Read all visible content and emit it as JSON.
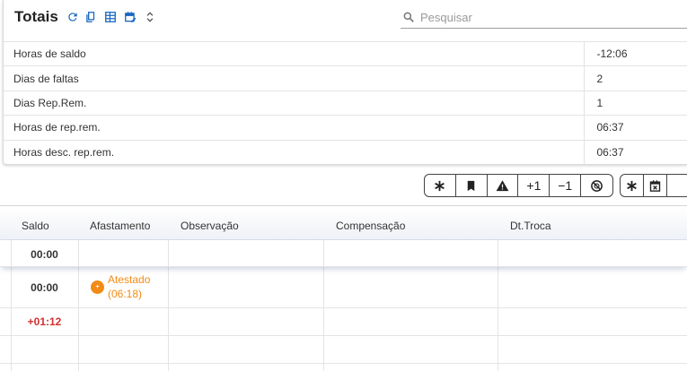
{
  "totals": {
    "title": "Totais",
    "search_placeholder": "Pesquisar",
    "search_value": "",
    "rows": [
      {
        "label": "Horas de saldo",
        "value": "-12:06"
      },
      {
        "label": "Dias de faltas",
        "value": "2"
      },
      {
        "label": "Dias Rep.Rem.",
        "value": "1"
      },
      {
        "label": "Horas de rep.rem.",
        "value": "06:37"
      },
      {
        "label": "Horas desc. rep.rem.",
        "value": "06:37"
      }
    ]
  },
  "toolbar": {
    "plus_one": "+1",
    "minus_one": "−1"
  },
  "grid": {
    "columns": {
      "saldo": "Saldo",
      "afastamento": "Afastamento",
      "observacao": "Observação",
      "compensacao": "Compensação",
      "dt_troca": "Dt.Troca"
    },
    "rows": [
      {
        "saldo": "00:00"
      },
      {
        "saldo": "00:00",
        "afastamento_line1": "Atestado",
        "afastamento_line2": "(06:18)"
      },
      {
        "saldo": "+01:12"
      }
    ],
    "colors": {
      "positive": "#d32f2f",
      "afastamento": "#f28a16"
    }
  },
  "accent_color": "#1565c0"
}
